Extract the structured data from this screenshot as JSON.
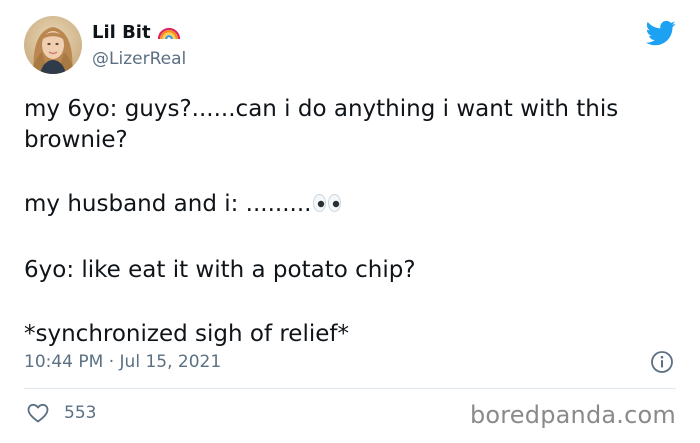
{
  "author": {
    "display_name": "Lil Bit",
    "handle": "@LizerReal",
    "badge_icon": "rainbow-icon"
  },
  "platform_icon": "twitter-bird-icon",
  "tweet": {
    "lines": [
      "my 6yo: guys?......can i do anything i want with this brownie?",
      "my husband and i: .........",
      "6yo: like eat it with a potato chip?",
      "*synchronized sigh of relief*"
    ],
    "emoji": "eyes-emoji"
  },
  "meta": {
    "time": "10:44 PM",
    "separator": "·",
    "date": "Jul 15, 2021",
    "info_icon": "info-icon"
  },
  "engagement": {
    "like_icon": "heart-icon",
    "likes": "553"
  },
  "watermark": "boredpanda.com",
  "colors": {
    "twitter_blue": "#1da1f2",
    "secondary_text": "#5b7083",
    "divider": "#e1e8ed"
  }
}
